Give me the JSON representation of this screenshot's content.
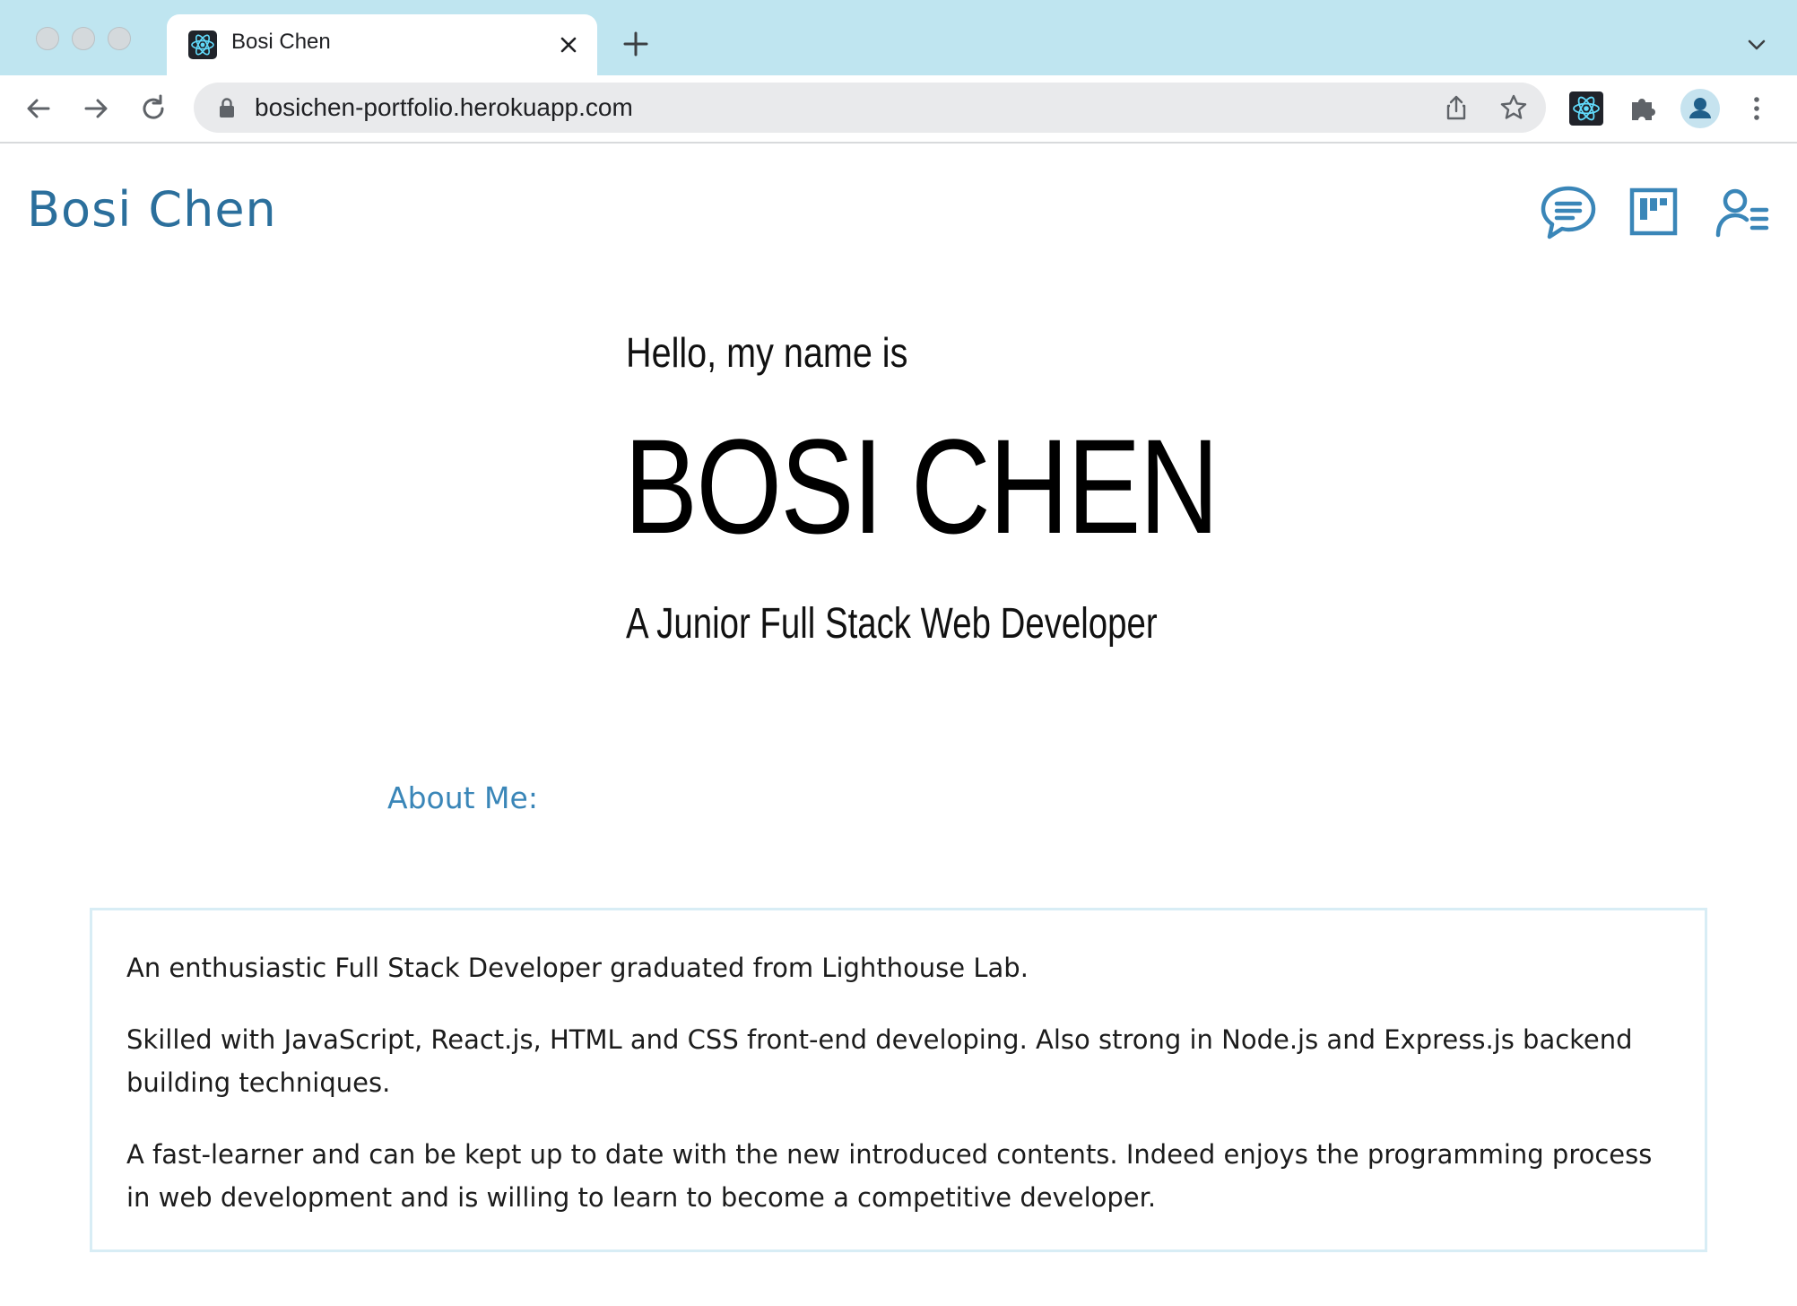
{
  "browser": {
    "tab": {
      "title": "Bosi Chen",
      "favicon": "react-logo-icon"
    },
    "url": "bosichen-portfolio.herokuapp.com",
    "icons": {
      "back": "arrow-left-icon",
      "forward": "arrow-right-icon",
      "reload": "reload-icon",
      "share": "share-icon",
      "bookmark": "star-icon",
      "extension": "react-devtools-icon",
      "extensions_menu": "puzzle-icon",
      "profile": "avatar-icon",
      "menu": "kebab-icon"
    }
  },
  "site": {
    "brand": "Bosi Chen",
    "nav_icons": [
      "chat-bubble-icon",
      "project-board-icon",
      "resume-icon"
    ],
    "accent_color": "#2b6f9c"
  },
  "hero": {
    "greeting": "Hello, my name is",
    "name": "BOSI CHEN",
    "subtitle": "A Junior Full Stack Web Developer"
  },
  "about": {
    "heading": "About Me:",
    "paragraphs": [
      "An enthusiastic Full Stack Developer graduated from Lighthouse Lab.",
      "Skilled with JavaScript, React.js, HTML and CSS front-end developing. Also strong in Node.js and Express.js backend building techniques.",
      "A fast-learner and can be kept up to date with the new introduced contents. Indeed enjoys the programming process in web development and is willing to learn to become a competitive developer."
    ]
  }
}
